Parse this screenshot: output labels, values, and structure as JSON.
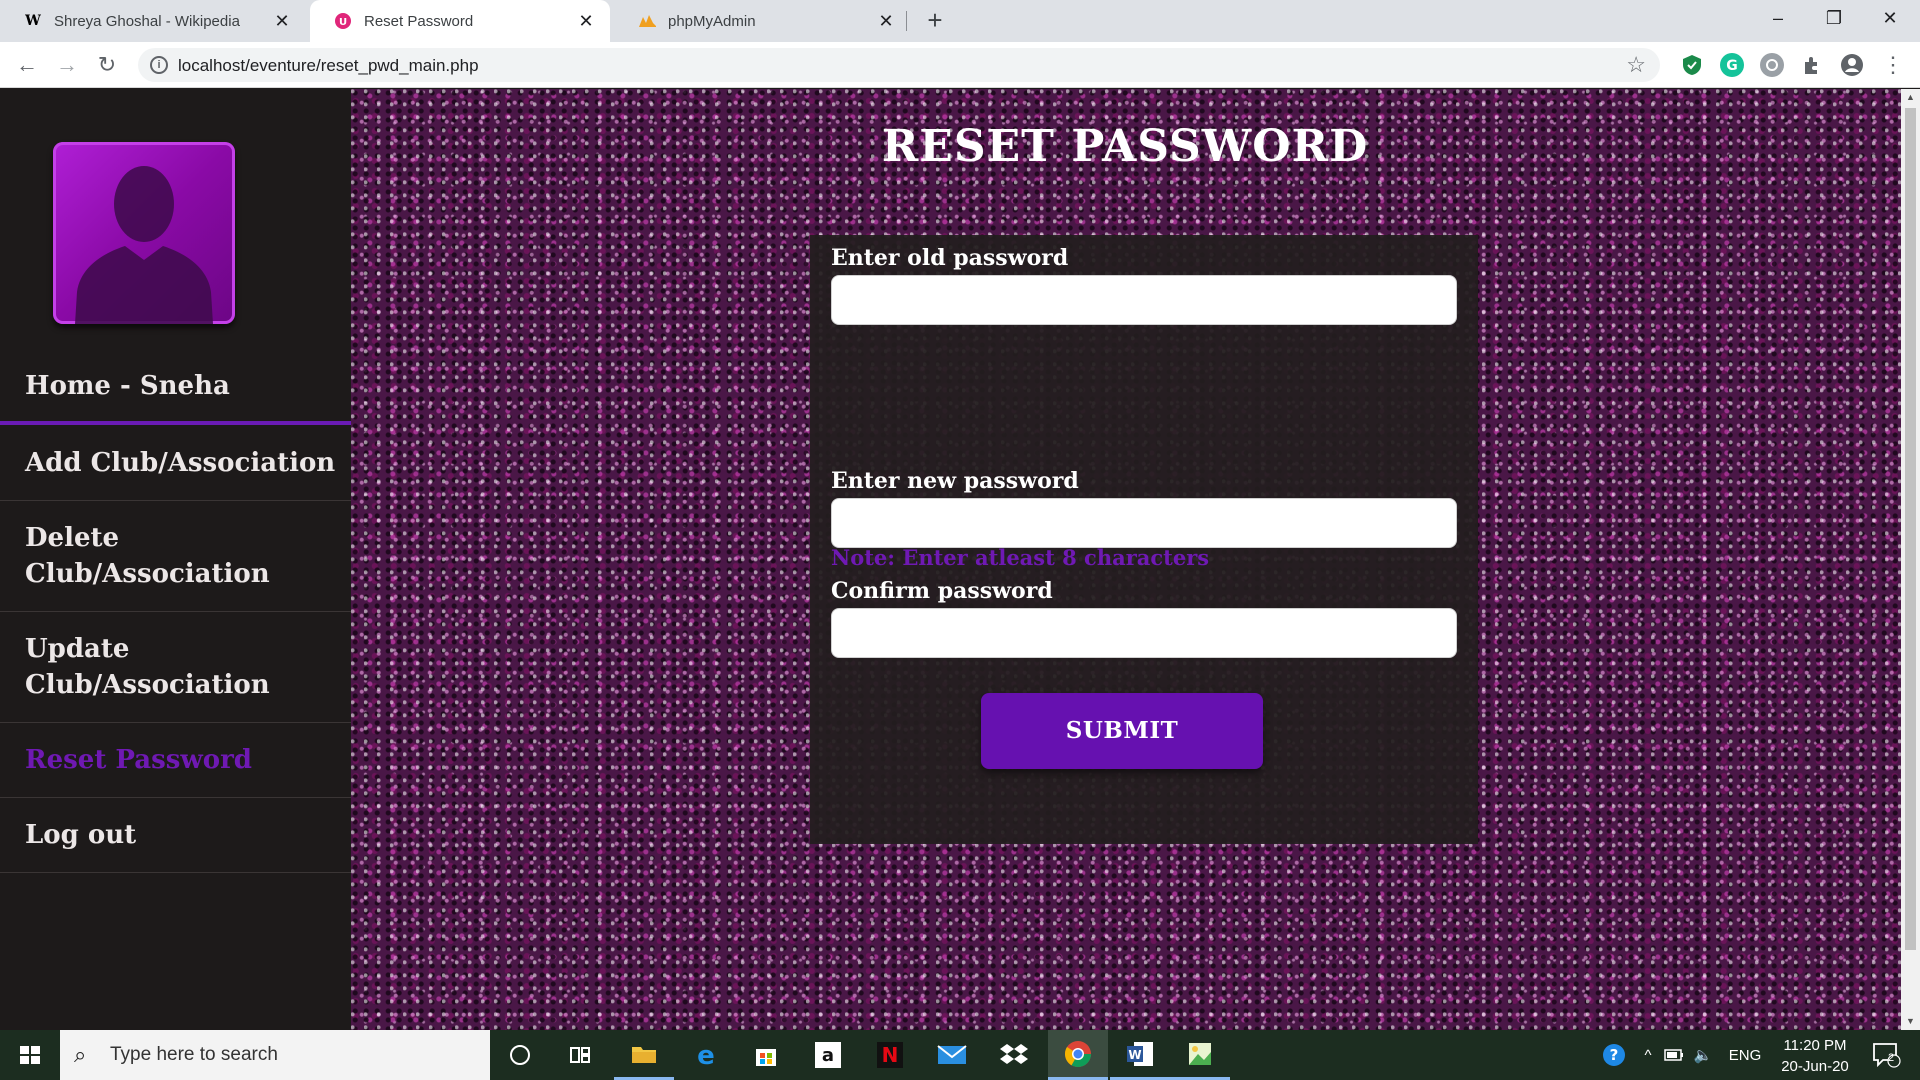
{
  "browser": {
    "tabs": [
      {
        "title": "Shreya Ghoshal - Wikipedia",
        "favicon": "W",
        "active": false
      },
      {
        "title": "Reset Password",
        "favicon": "localhost-icon",
        "active": true
      },
      {
        "title": "phpMyAdmin",
        "favicon": "pma-icon",
        "active": false
      }
    ],
    "url": "localhost/eventure/reset_pwd_main.php"
  },
  "sidebar": {
    "items": [
      {
        "label": "Home - Sneha"
      },
      {
        "label": "Add Club/Association"
      },
      {
        "label": "Delete Club/Association"
      },
      {
        "label": "Update Club/Association"
      },
      {
        "label": "Reset Password",
        "active": true
      },
      {
        "label": "Log out"
      }
    ]
  },
  "main": {
    "title": "RESET PASSWORD",
    "old_password_label": "Enter old password",
    "note": "Note: Enter atleast 8 characters",
    "new_password_label": "Enter new password",
    "confirm_password_label": "Confirm password",
    "submit_label": "SUBMIT"
  },
  "taskbar": {
    "search_placeholder": "Type here to search",
    "language": "ENG",
    "time": "11:20 PM",
    "date": "20-Jun-20",
    "notification_count": "2"
  },
  "colors": {
    "sidebar_bg": "#1d1a1a",
    "accent_purple": "#6611b0",
    "active_link": "#6f19b3",
    "glitter_bg": "#4a1747"
  }
}
